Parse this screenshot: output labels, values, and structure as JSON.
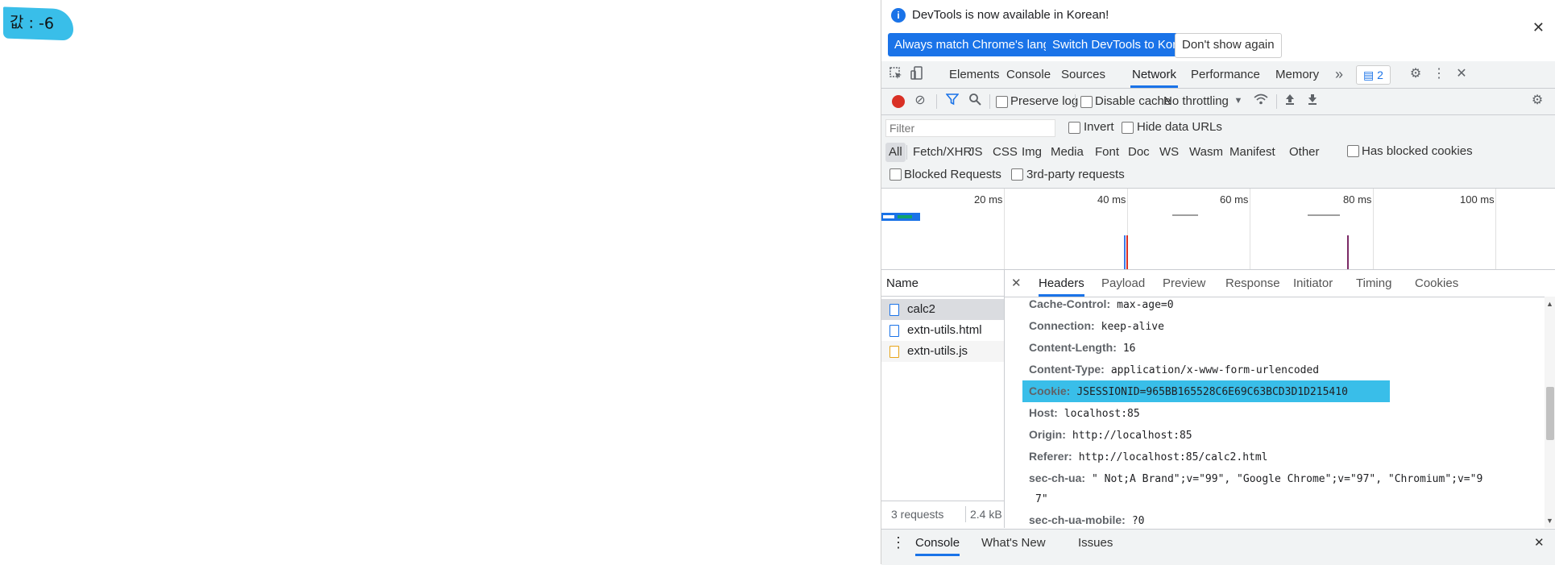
{
  "page": {
    "value_text": "값 : -6"
  },
  "devtools": {
    "banner": {
      "message": "DevTools is now available in Korean!",
      "btn_match": "Always match Chrome's language",
      "btn_switch": "Switch DevTools to Korean",
      "btn_dont": "Don't show again"
    },
    "tabs": [
      "Elements",
      "Console",
      "Sources",
      "Network",
      "Performance",
      "Memory"
    ],
    "active_tab": "Network",
    "issues_count": "2",
    "toolbar": {
      "preserve_log": "Preserve log",
      "disable_cache": "Disable cache",
      "throttling": "No throttling"
    },
    "filter": {
      "placeholder": "Filter",
      "invert": "Invert",
      "hide_data_urls": "Hide data URLs",
      "types": [
        "All",
        "Fetch/XHR",
        "JS",
        "CSS",
        "Img",
        "Media",
        "Font",
        "Doc",
        "WS",
        "Wasm",
        "Manifest",
        "Other"
      ],
      "active_type": "All",
      "has_blocked_cookies": "Has blocked cookies",
      "blocked_requests": "Blocked Requests",
      "third_party": "3rd-party requests"
    },
    "timeline": {
      "ticks": [
        "20 ms",
        "40 ms",
        "60 ms",
        "80 ms",
        "100 ms"
      ]
    },
    "requests": {
      "header": "Name",
      "items": [
        "calc2",
        "extn-utils.html",
        "extn-utils.js"
      ],
      "selected": "calc2",
      "count": "3 requests",
      "size": "2.4 kB"
    },
    "detail": {
      "tabs": [
        "Headers",
        "Payload",
        "Preview",
        "Response",
        "Initiator",
        "Timing",
        "Cookies"
      ],
      "active_tab": "Headers",
      "headers": [
        {
          "name": "Cache-Control:",
          "value": "max-age=0"
        },
        {
          "name": "Connection:",
          "value": "keep-alive"
        },
        {
          "name": "Content-Length:",
          "value": "16"
        },
        {
          "name": "Content-Type:",
          "value": "application/x-www-form-urlencoded"
        },
        {
          "name": "Cookie:",
          "value": "JSESSIONID=965BB165528C6E69C63BCD3D1D215410"
        },
        {
          "name": "Host:",
          "value": "localhost:85"
        },
        {
          "name": "Origin:",
          "value": "http://localhost:85"
        },
        {
          "name": "Referer:",
          "value": "http://localhost:85/calc2.html"
        },
        {
          "name": "sec-ch-ua:",
          "value": "\" Not;A Brand\";v=\"99\", \"Google Chrome\";v=\"97\", \"Chromium\";v=\"9"
        },
        {
          "name": "",
          "value": "7\""
        },
        {
          "name": "sec-ch-ua-mobile:",
          "value": "?0"
        }
      ],
      "highlighted_header": "Cookie:"
    },
    "drawer": {
      "tabs": [
        "Console",
        "What's New",
        "Issues"
      ],
      "active_tab": "Console"
    }
  },
  "colors": {
    "accent": "#1a73e8",
    "highlight": "#39bee9",
    "record": "#d93025"
  }
}
